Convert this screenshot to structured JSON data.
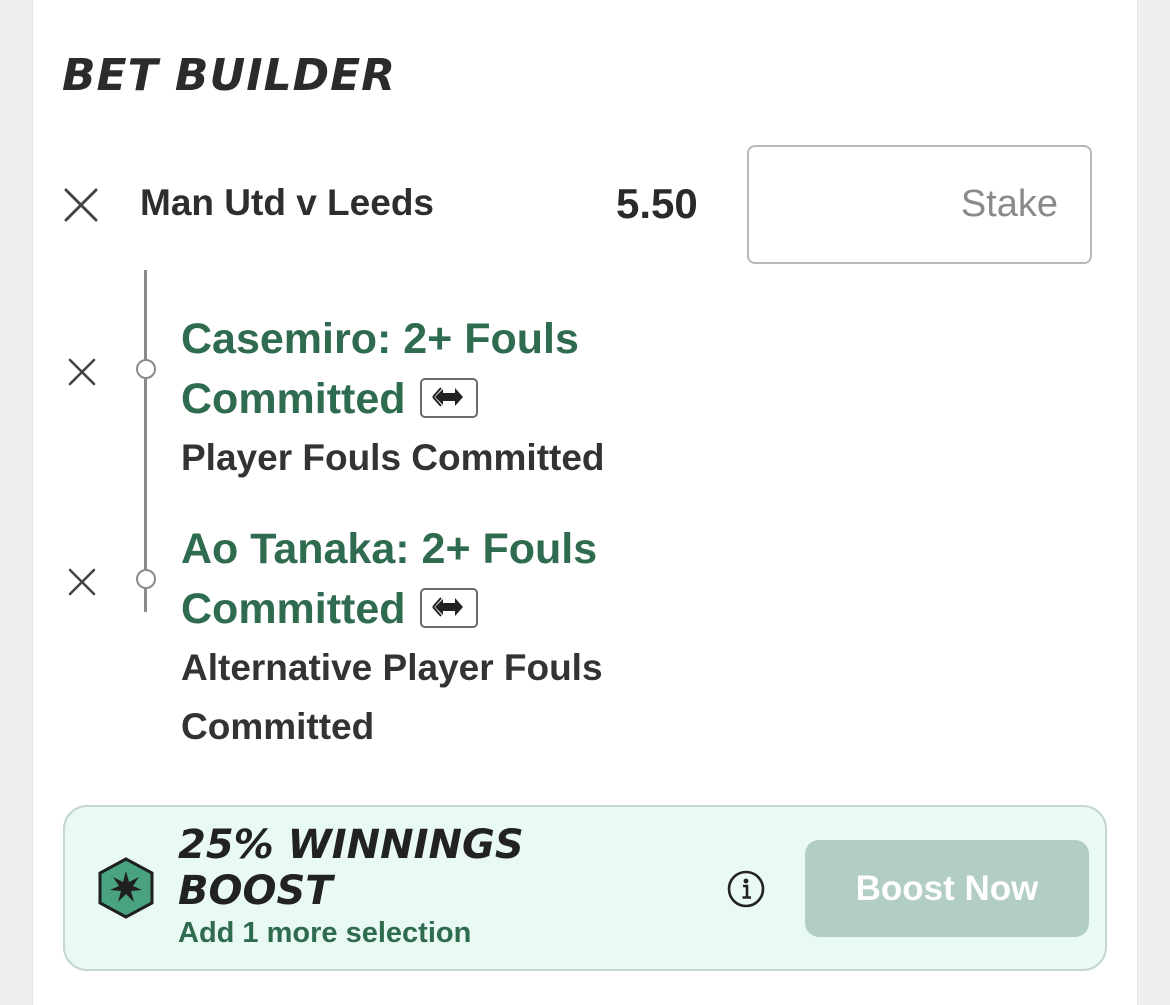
{
  "header": {
    "title": "BET BUILDER"
  },
  "event": {
    "name": "Man Utd v Leeds",
    "odds": "5.50",
    "stake_placeholder": "Stake"
  },
  "selections": [
    {
      "title": "Casemiro: 2+ Fouls Committed",
      "market": "Player Fouls Committed"
    },
    {
      "title": "Ao Tanaka: 2+ Fouls Committed",
      "market": "Alternative Player Fouls Committed"
    }
  ],
  "boost": {
    "title": "25% WINNINGS BOOST",
    "subtitle": "Add 1 more selection",
    "button_label": "Boost Now"
  },
  "colors": {
    "selection_green": "#2f6b4f",
    "boost_bg": "#e9f9f3",
    "boost_button": "#b2cdc2",
    "hex_green": "#4aa380"
  },
  "icons": [
    "close-icon",
    "swap-icon",
    "boost-hexagon-icon",
    "info-icon"
  ]
}
